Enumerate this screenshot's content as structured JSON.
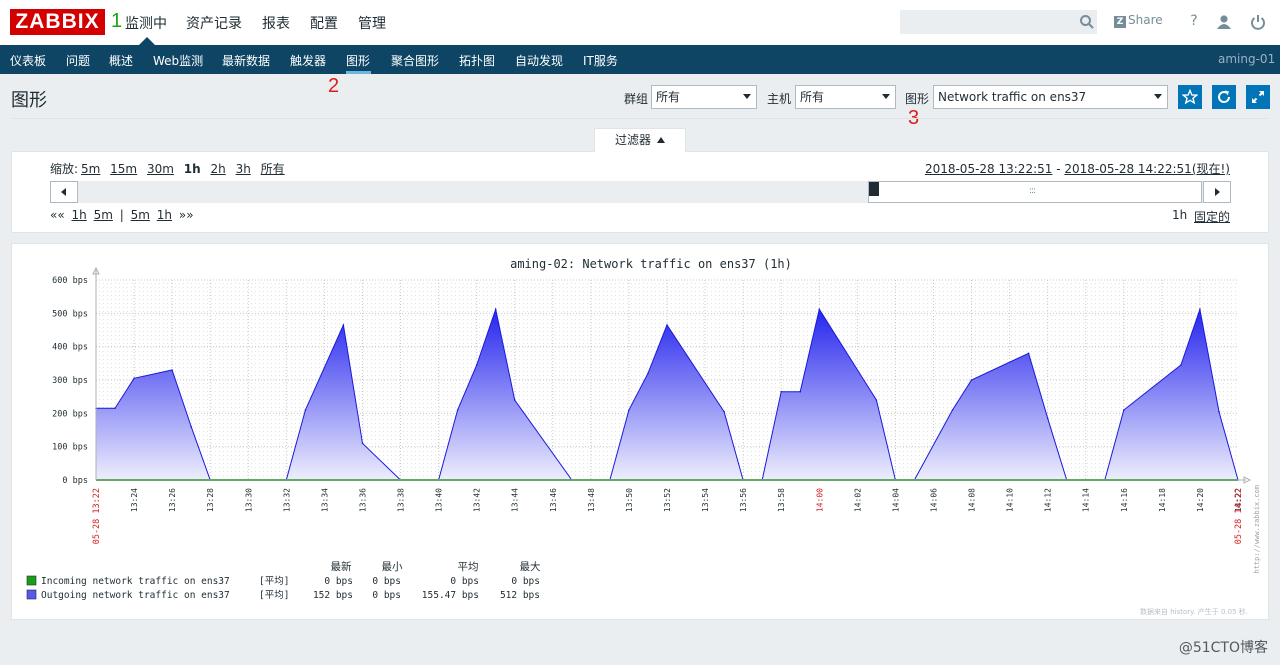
{
  "header": {
    "logo": "ZABBIX",
    "annotation_1": "1",
    "main_menu": [
      "监测中",
      "资产记录",
      "报表",
      "配置",
      "管理"
    ],
    "share_label": "Share",
    "help_label": "?"
  },
  "submenu": {
    "items": [
      "仪表板",
      "问题",
      "概述",
      "Web监测",
      "最新数据",
      "触发器",
      "图形",
      "聚合图形",
      "拓扑图",
      "自动发现",
      "IT服务"
    ],
    "active": "图形",
    "annotation_2": "2",
    "server_name": "aming-01"
  },
  "page": {
    "title": "图形",
    "group_label": "群组",
    "group_value": "所有",
    "host_label": "主机",
    "host_value": "所有",
    "graph_label": "图形",
    "graph_value": "Network traffic on ens37",
    "annotation_3": "3",
    "icons": [
      "star-icon",
      "refresh-icon",
      "fullscreen-icon"
    ]
  },
  "filter": {
    "tab_label": "过滤器",
    "zoom_label": "缩放:",
    "zoom_options": [
      "5m",
      "15m",
      "30m",
      "1h",
      "2h",
      "3h",
      "所有"
    ],
    "zoom_selected": "1h",
    "time_from": "2018-05-28 13:22:51",
    "time_sep": " - ",
    "time_to": "2018-05-28 14:22:51",
    "time_now": "(现在!)",
    "nav_left": [
      "««",
      "1h",
      "5m",
      "|",
      "5m",
      "1h",
      "»»"
    ],
    "period": "1h",
    "fixed_label": "固定的"
  },
  "graph": {
    "title": "aming-02: Network traffic on ens37 (1h)",
    "y_ticks": [
      "600 bps",
      "500 bps",
      "400 bps",
      "300 bps",
      "200 bps",
      "100 bps",
      "0 bps"
    ],
    "x_ticks": [
      "13:24",
      "13:26",
      "13:28",
      "13:30",
      "13:32",
      "13:34",
      "13:36",
      "13:38",
      "13:40",
      "13:42",
      "13:44",
      "13:46",
      "13:48",
      "13:50",
      "13:52",
      "13:54",
      "13:56",
      "13:58",
      "14:00",
      "14:02",
      "14:04",
      "14:06",
      "14:08",
      "14:10",
      "14:12",
      "14:14",
      "14:16",
      "14:18",
      "14:20",
      "14:22"
    ],
    "x_start_label": "05-28 13:22",
    "x_end_label": "05-28 14:22",
    "side_url": "http://www.zabbix.com",
    "legend_headers": [
      "最新",
      "最小",
      "平均",
      "最大"
    ],
    "legend": [
      {
        "name": "Incoming network traffic on ens37",
        "func": "[平均]",
        "last": "0 bps",
        "min": "0 bps",
        "avg": "0 bps",
        "max": "0 bps",
        "color": "#1a9e1a"
      },
      {
        "name": "Outgoing network traffic on ens37",
        "func": "[平均]",
        "last": "152 bps",
        "min": "0 bps",
        "avg": "155.47 bps",
        "max": "512 bps",
        "color": "#5959f0"
      }
    ],
    "footer": "数据来自 history. 产生于 0.05 秒."
  },
  "watermark": "@51CTO博客",
  "chart_data": {
    "type": "area",
    "title": "aming-02: Network traffic on ens37 (1h)",
    "xlabel": "",
    "ylabel": "",
    "ylim": [
      0,
      600
    ],
    "x_range": [
      "2018-05-28 13:22",
      "2018-05-28 14:22"
    ],
    "grid": true,
    "series": [
      {
        "name": "Incoming network traffic on ens37",
        "x": [
          "13:22",
          "14:22"
        ],
        "values": [
          0,
          0
        ]
      },
      {
        "name": "Outgoing network traffic on ens37",
        "x": [
          "13:22",
          "13:23",
          "13:24",
          "13:26",
          "13:27",
          "13:28",
          "13:31",
          "13:32",
          "13:33",
          "13:35",
          "13:36",
          "13:38",
          "13:39",
          "13:40",
          "13:41",
          "13:42",
          "13:43",
          "13:44",
          "13:47",
          "13:48",
          "13:49",
          "13:50",
          "13:51",
          "13:52",
          "13:55",
          "13:56",
          "13:57",
          "13:58",
          "13:59",
          "14:00",
          "14:03",
          "14:04",
          "14:05",
          "14:07",
          "14:08",
          "14:11",
          "14:12",
          "14:13",
          "14:14",
          "14:15",
          "14:16",
          "14:19",
          "14:20",
          "14:21",
          "14:22"
        ],
        "values": [
          215,
          215,
          305,
          330,
          160,
          0,
          0,
          0,
          210,
          465,
          110,
          0,
          0,
          0,
          210,
          345,
          512,
          240,
          0,
          0,
          0,
          210,
          320,
          465,
          205,
          0,
          0,
          265,
          265,
          512,
          240,
          0,
          0,
          210,
          300,
          380,
          185,
          0,
          0,
          0,
          210,
          345,
          512,
          205,
          0
        ]
      }
    ]
  }
}
